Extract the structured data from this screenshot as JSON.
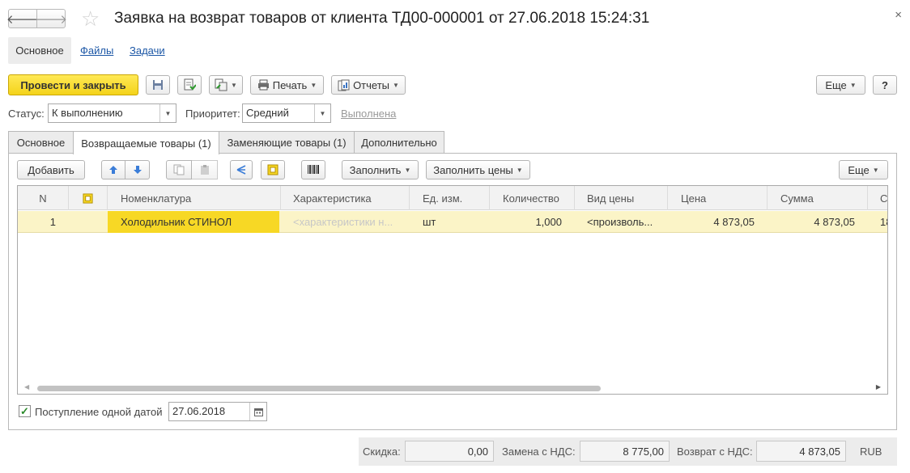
{
  "window": {
    "title": "Заявка на возврат товаров от клиента ТД00-000001 от 27.06.2018 15:24:31",
    "back_glyph": "🡐",
    "forward_glyph": "🡒",
    "close_glyph": "×"
  },
  "sections": {
    "main": "Основное",
    "files": "Файлы",
    "tasks": "Задачи"
  },
  "toolbar": {
    "post_close": "Провести и закрыть",
    "print": "Печать",
    "reports": "Отчеты",
    "more": "Еще",
    "help": "?"
  },
  "fields": {
    "status_label": "Статус:",
    "status_value": "К выполнению",
    "priority_label": "Приоритет:",
    "priority_value": "Средний",
    "done_link": "Выполнена"
  },
  "tabs": [
    {
      "label": "Основное",
      "active": false
    },
    {
      "label": "Возвращаемые товары (1)",
      "active": true
    },
    {
      "label": "Заменяющие товары (1)",
      "active": false
    },
    {
      "label": "Дополнительно",
      "active": false
    }
  ],
  "table_toolbar": {
    "add": "Добавить",
    "fill": "Заполнить",
    "fill_prices": "Заполнить цены",
    "more": "Еще"
  },
  "table": {
    "columns": [
      "N",
      "",
      "Номенклатура",
      "Характеристика",
      "Ед. изм.",
      "Количество",
      "Вид цены",
      "Цена",
      "Сумма",
      "С"
    ],
    "rows": [
      {
        "n": "1",
        "nomenclature": "Холодильник СТИНОЛ",
        "characteristic": "<характеристики н...",
        "unit": "шт",
        "quantity": "1,000",
        "price_type": "<произволь...",
        "price": "4 873,05",
        "sum": "4 873,05",
        "extra": "18"
      }
    ]
  },
  "receipt": {
    "label": "Поступление одной датой",
    "checked": true,
    "date": "27.06.2018"
  },
  "totals": {
    "discount_label": "Скидка:",
    "discount_value": "0,00",
    "replacement_label": "Замена с НДС:",
    "replacement_value": "8 775,00",
    "return_label": "Возврат с НДС:",
    "return_value": "4 873,05",
    "currency": "RUB"
  },
  "colors": {
    "accent_yellow": "#f4d31a",
    "row_highlight": "#fbf4c7",
    "link_blue": "#1c57a6"
  }
}
